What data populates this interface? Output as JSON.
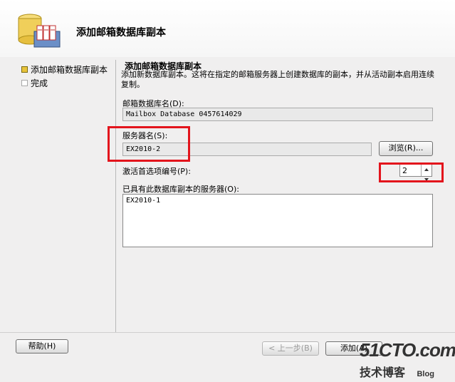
{
  "header": {
    "title": "添加邮箱数据库副本"
  },
  "sidebar": {
    "steps": [
      {
        "label": "添加邮箱数据库副本",
        "state": "active"
      },
      {
        "label": "完成",
        "state": "pending"
      }
    ]
  },
  "main": {
    "section_title": "添加邮箱数据库副本",
    "description": "添加新数据库副本。这将在指定的邮箱服务器上创建数据库的副本，并从活动副本启用连续复制。",
    "database_label": "邮箱数据库名(D):",
    "database_value": "Mailbox Database 0457614029",
    "server_label": "服务器名(S):",
    "server_value": "EX2010-2",
    "browse_label": "浏览(R)...",
    "activation_label": "激活首选项编号(P):",
    "activation_value": "2",
    "existing_label": "已具有此数据库副本的服务器(O):",
    "existing_servers": [
      "EX2010-1"
    ]
  },
  "footer": {
    "help_label": "帮助(H)",
    "back_label": "< 上一步(B)",
    "add_label": "添加(A)"
  },
  "watermark": {
    "brand": "51CTO.com",
    "subtitle": "技术博客",
    "blog": "Blog"
  },
  "colors": {
    "highlight": "#e3141c",
    "active_marker": "#e8c33a"
  }
}
